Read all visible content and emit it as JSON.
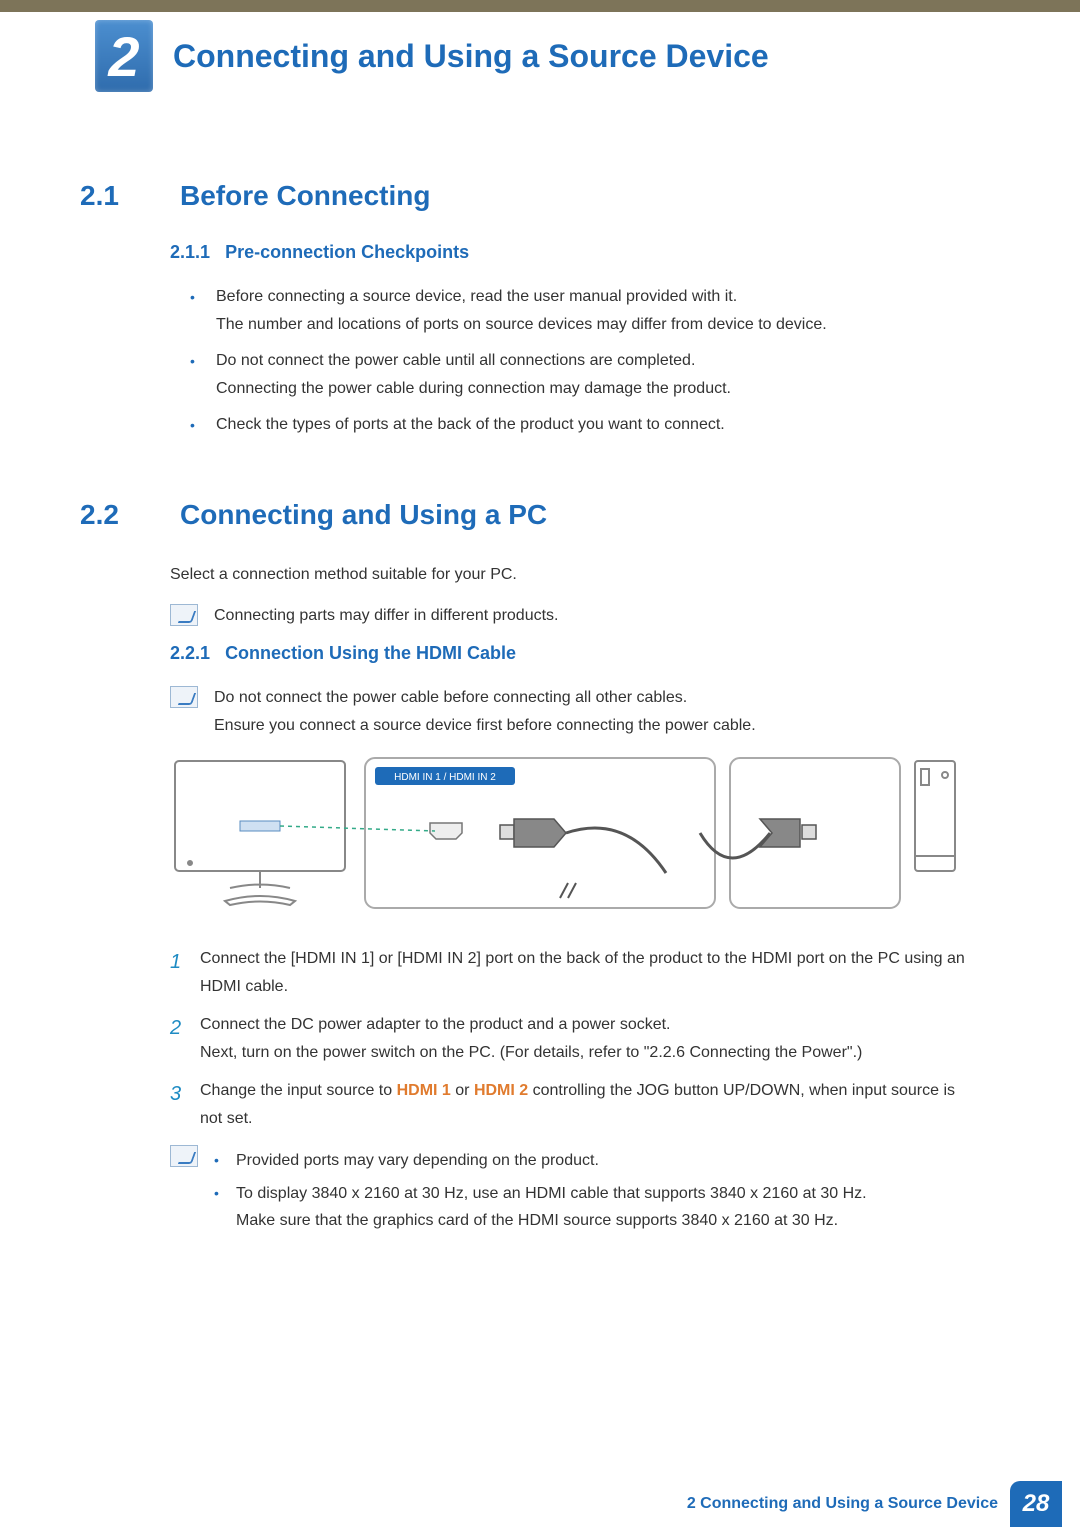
{
  "chapter": {
    "number": "2",
    "title": "Connecting and Using a Source Device"
  },
  "section1": {
    "number": "2.1",
    "title": "Before Connecting",
    "subsection": {
      "number": "2.1.1",
      "title": "Pre-connection Checkpoints"
    },
    "bullets": [
      {
        "line1": "Before connecting a source device, read the user manual provided with it.",
        "line2": "The number and locations of ports on source devices may differ from device to device."
      },
      {
        "line1": "Do not connect the power cable until all connections are completed.",
        "line2": "Connecting the power cable during connection may damage the product."
      },
      {
        "line1": "Check the types of ports at the back of the product you want to connect."
      }
    ]
  },
  "section2": {
    "number": "2.2",
    "title": "Connecting and Using a PC",
    "intro": "Select a connection method suitable for your PC.",
    "note1": "Connecting parts may differ in different products.",
    "subsection": {
      "number": "2.2.1",
      "title": "Connection Using the HDMI Cable"
    },
    "note2_line1": "Do not connect the power cable before connecting all other cables.",
    "note2_line2": "Ensure you connect a source device first before connecting the power cable.",
    "diagram": {
      "port_label": "HDMI IN 1 / HDMI IN 2"
    },
    "steps": {
      "s1": "Connect the [HDMI IN 1] or [HDMI IN 2] port on the back of the product to the HDMI port on the PC using an HDMI cable.",
      "s2_line1": "Connect the DC power adapter to the product and a power socket.",
      "s2_line2": "Next, turn on the power switch on the PC. (For details, refer to \"2.2.6     Connecting the Power\".)",
      "s3_pre": "Change the input source to ",
      "s3_h1": "HDMI 1",
      "s3_or": " or ",
      "s3_h2": "HDMI 2",
      "s3_post": " controlling the JOG button UP/DOWN, when input source is not set."
    },
    "note3": {
      "b1": "Provided ports may vary depending on the product.",
      "b2_line1": "To display 3840 x 2160 at 30 Hz, use an HDMI cable that supports 3840 x 2160 at 30 Hz.",
      "b2_line2": "Make sure that the graphics card of the HDMI source supports 3840 x 2160 at 30 Hz."
    }
  },
  "footer": {
    "text": "2 Connecting and Using a Source Device",
    "page": "28"
  }
}
